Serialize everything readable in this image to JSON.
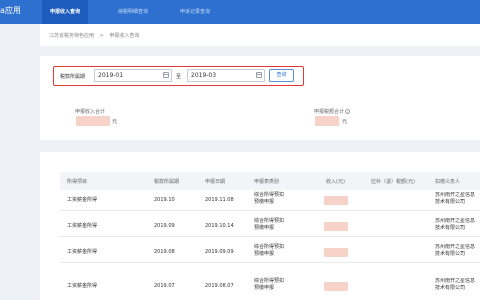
{
  "app": {
    "title": "a应用"
  },
  "nav": {
    "tabs": [
      {
        "label": "申报收入查询",
        "active": true
      },
      {
        "label": "纳税明细查询",
        "active": false
      },
      {
        "label": "申诉记录查询",
        "active": false
      }
    ]
  },
  "breadcrumb": {
    "items": [
      "江苏省税务特色应用",
      ">",
      "申报收入查询"
    ]
  },
  "filter": {
    "period_label": "税款所属期",
    "start_value": "2019-01",
    "separator": "至",
    "end_value": "2019-03",
    "query_label": "查询"
  },
  "totals": {
    "income_label": "申报收入合计",
    "income_unit": "元",
    "tax_label": "申报税额合计",
    "tax_unit": "元",
    "info_glyph": "i"
  },
  "table": {
    "headers": [
      "所得项目",
      "税款所属期",
      "申报日期",
      "申报表类别",
      "收入(元)",
      "应补（退）税额(元)",
      "扣缴义务人"
    ],
    "rows": [
      {
        "item": "工资薪金所得",
        "period": "2019.10",
        "date": "2019.11.08",
        "category": "综合所得预扣预缴申报",
        "payer": "苏州南开之星信息技术有限公司"
      },
      {
        "item": "工资薪金所得",
        "period": "2019.09",
        "date": "2019.10.14",
        "category": "综合所得预扣预缴申报",
        "payer": "苏州南开之星信息技术有限公司"
      },
      {
        "item": "工资薪金所得",
        "period": "2019.08",
        "date": "2019.09.09",
        "category": "综合所得预扣预缴申报",
        "payer": "苏州南开之星信息技术有限公司"
      },
      {
        "item": "工资薪金所得",
        "period": "2019.07",
        "date": "2019.08.07",
        "category": "综合所得预扣预缴申报",
        "payer": "苏州南开之星信息技术有限公司"
      }
    ]
  },
  "colors": {
    "nav_bg": "#2d70d0",
    "nav_active_bg": "#1d5cbc",
    "highlight_border": "#e53935",
    "redacted_fill": "#f6d2c8"
  }
}
